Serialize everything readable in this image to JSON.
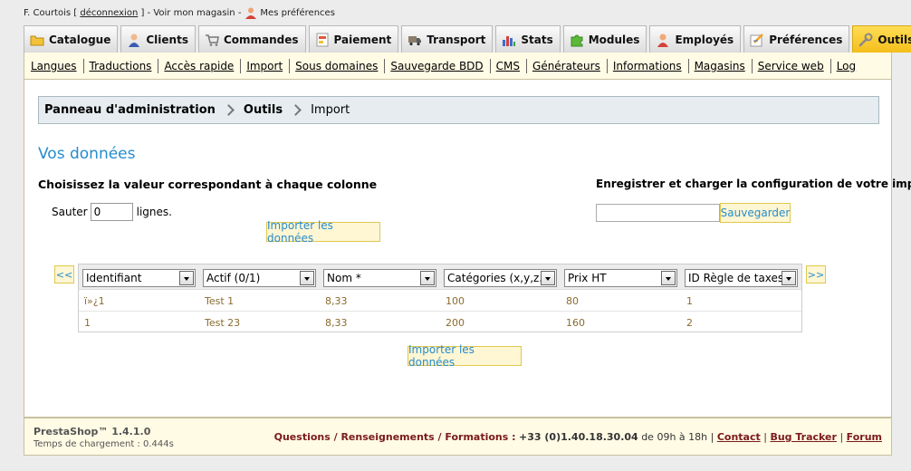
{
  "topbar": {
    "user_name": "F. Courtois [",
    "logout": "déconnexion",
    "after_logout": "] - Voir mon magasin -",
    "preferences": "Mes préférences"
  },
  "tabs": [
    {
      "label": "Catalogue",
      "icon": "folder-icon"
    },
    {
      "label": "Clients",
      "icon": "customer-icon"
    },
    {
      "label": "Commandes",
      "icon": "cart-icon"
    },
    {
      "label": "Paiement",
      "icon": "payment-icon"
    },
    {
      "label": "Transport",
      "icon": "truck-icon"
    },
    {
      "label": "Stats",
      "icon": "bar-chart-icon"
    },
    {
      "label": "Modules",
      "icon": "puzzle-icon"
    },
    {
      "label": "Employés",
      "icon": "employee-icon"
    },
    {
      "label": "Préférences",
      "icon": "preferences-icon"
    },
    {
      "label": "Outils",
      "icon": "wrench-icon",
      "active": true
    }
  ],
  "subnav": [
    "Langues",
    "Traductions",
    "Accès rapide",
    "Import",
    "Sous domaines",
    "Sauvegarde BDD",
    "CMS",
    "Générateurs",
    "Informations",
    "Magasins",
    "Service web",
    "Log"
  ],
  "breadcrumb": {
    "root": "Panneau d'administration",
    "section": "Outils",
    "current": "Import"
  },
  "main": {
    "section_title": "Vos données",
    "choose_title": "Choisissez la valeur correspondant à chaque colonne",
    "skip_label": "Sauter",
    "skip_value": "0",
    "skip_suffix": "lignes.",
    "import_button": "Importer les données",
    "config_title": "Enregistrer et charger la configuration de votre import :",
    "config_placeholder": "",
    "save_button": "Sauvegarder",
    "prev_arrow": "<<",
    "next_arrow": ">>"
  },
  "grid": {
    "columns": [
      "Identifiant",
      "Actif (0/1)",
      "Nom *",
      "Catégories (x,y,z...)",
      "Prix HT",
      "ID Règle de taxes"
    ],
    "rows": [
      [
        "ï»¿1",
        "Test 1",
        "8,33",
        "100",
        "80",
        "1"
      ],
      [
        "1",
        "Test 23",
        "8,33",
        "200",
        "160",
        "2"
      ]
    ]
  },
  "footer": {
    "brand": "PrestaShop™ 1.4.1.0",
    "load_time": "Temps de chargement : 0.444s",
    "questions": "Questions / Renseignements / Formations :",
    "phone": "+33 (0)1.40.18.30.04",
    "hours": "de 09h à 18h |",
    "contact": "Contact",
    "bug_tracker": "Bug Tracker",
    "forum": "Forum"
  },
  "colors": {
    "accent_blue": "#268ccd",
    "active_tab": "#f4be1b",
    "footer_link": "#7b1a1a"
  }
}
